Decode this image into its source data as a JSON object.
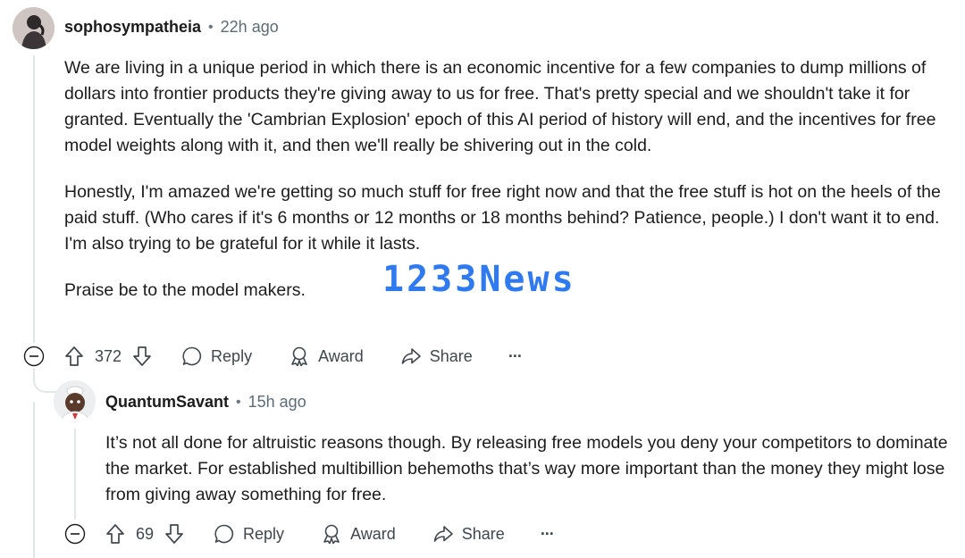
{
  "comments": [
    {
      "author": "sophosympatheia",
      "separator": "•",
      "time": "22h ago",
      "paragraphs": [
        "We are living in a unique period in which there is an economic incentive for a few companies to dump millions of dollars into frontier products they're giving away to us for free. That's pretty special and we shouldn't take it for granted. Eventually the 'Cambrian Explosion' epoch of this AI period of history will end, and the incentives for free model weights along with it, and then we'll really be shivering out in the cold.",
        "Honestly, I'm amazed we're getting so much stuff for free right now and that the free stuff is hot on the heels of the paid stuff. (Who cares if it's 6 months or 12 months or 18 months behind? Patience, people.) I don't want it to end. I'm also trying to be grateful for it while it lasts.",
        "Praise be to the model makers."
      ],
      "score": "372",
      "actions": {
        "reply": "Reply",
        "award": "Award",
        "share": "Share",
        "more": "···"
      }
    },
    {
      "author": "QuantumSavant",
      "separator": "•",
      "time": "15h ago",
      "paragraphs": [
        "It’s not all done for altruistic reasons though. By releasing free models you deny your competitors to dominate the market. For established multibillion behemoths that’s way more important than the money they might lose from giving away something for free."
      ],
      "score": "69",
      "actions": {
        "reply": "Reply",
        "award": "Award",
        "share": "Share",
        "more": "···"
      }
    }
  ],
  "watermark": "1233News",
  "icons": [
    "upvote-icon",
    "downvote-icon",
    "comment-icon",
    "award-icon",
    "share-icon",
    "more-icon",
    "collapse-icon"
  ],
  "colors": {
    "text": "#1c1c1c",
    "meta": "#5c6c74",
    "action": "#40474c",
    "thread": "#e3e6e8",
    "watermark": "#1e6ff0"
  }
}
